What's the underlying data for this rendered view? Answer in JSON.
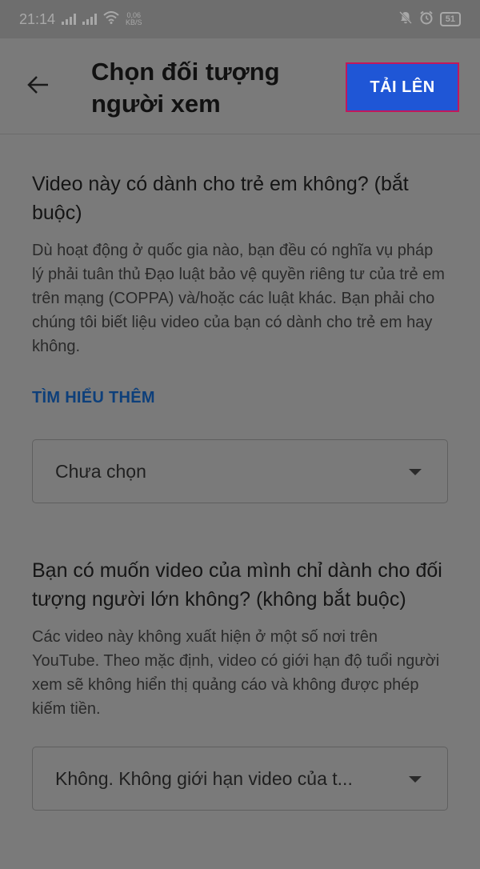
{
  "status_bar": {
    "time": "21:14",
    "net_speed_value": "0,06",
    "net_speed_unit": "KB/S",
    "battery": "51"
  },
  "header": {
    "title": "Chọn đối tượng người xem",
    "upload_label": "TẢI LÊN"
  },
  "section_kids": {
    "question": "Video này có dành cho trẻ em không? (bắt buộc)",
    "description": "Dù hoạt động ở quốc gia nào, bạn đều có nghĩa vụ pháp lý phải tuân thủ Đạo luật bảo vệ quyền riêng tư của trẻ em trên mạng (COPPA) và/hoặc các luật khác. Bạn phải cho chúng tôi biết liệu video của bạn có dành cho trẻ em hay không.",
    "learn_more": "TÌM HIỂU THÊM",
    "select_value": "Chưa chọn"
  },
  "section_adult": {
    "question": "Bạn có muốn video của mình chỉ dành cho đối tượng người lớn không? (không bắt buộc)",
    "description": "Các video này không xuất hiện ở một số nơi trên YouTube. Theo mặc định, video có giới hạn độ tuổi người xem sẽ không hiển thị quảng cáo và không được phép kiếm tiền.",
    "select_value": "Không. Không giới hạn video của t..."
  },
  "colors": {
    "upload_button": "#1f56d6",
    "upload_border": "#c2185b",
    "link": "#0d3f7a",
    "background": "#7a7a7a"
  }
}
